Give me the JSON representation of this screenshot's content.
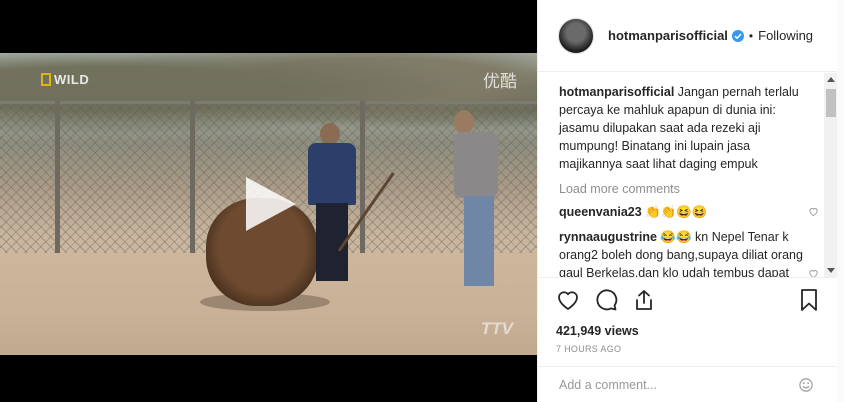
{
  "video": {
    "logo_text": "WILD",
    "watermark_top": "优酷",
    "watermark_bottom": "TTV"
  },
  "post": {
    "username": "hotmanparisofficial",
    "follow_status": "Following",
    "caption_user": "hotmanparisofficial",
    "caption_text": "Jangan pernah terlalu percaya ke mahluk apapun di dunia ini: jasamu dilupakan saat ada rezeki aji mumpung! Binatang ini lupain jasa majikannya saat lihat daging empuk",
    "load_more": "Load more comments",
    "comments": [
      {
        "user": "queenvania23",
        "text": "👏👏😆😆"
      },
      {
        "user": "rynnaaugustrine",
        "text": "😂😂 kn Nepel Tenar k orang2 boleh dong bang,supaya diliat orang gaul Berkelas,dan klo udah tembus dapat"
      }
    ],
    "views": "421,949 views",
    "time_ago": "7 HOURS AGO",
    "add_comment_placeholder": "Add a comment..."
  },
  "colors": {
    "verified_blue": "#3897f0",
    "text_primary": "#262626",
    "text_muted": "#8e8e8e"
  },
  "icons": [
    "play-icon",
    "verified-badge-icon",
    "heart-icon",
    "comment-icon",
    "share-icon",
    "bookmark-icon",
    "small-heart-icon",
    "emoji-icon"
  ]
}
